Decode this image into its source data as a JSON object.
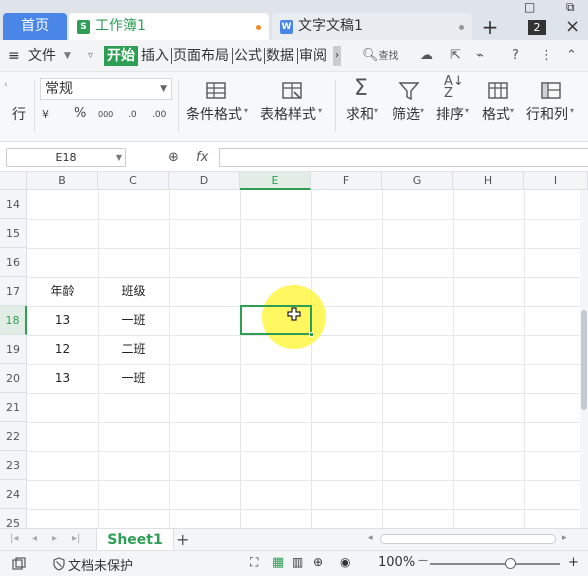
{
  "tabs": {
    "home": "首页",
    "workbook": "工作簿1",
    "workbook_icon": "S",
    "document": "文字文稿1",
    "document_icon": "W",
    "add": "+"
  },
  "window": {
    "minimize": "□",
    "restore": "⧉",
    "avatar_badge": "2",
    "close": "×"
  },
  "menu": {
    "file": "文件",
    "items": [
      "开始",
      "插入",
      "页面布局",
      "公式",
      "数据",
      "审阅"
    ],
    "search": "查找",
    "help": "?"
  },
  "ribbon": {
    "row_partial": "行",
    "number_format": "常规",
    "format_buttons": [
      "¥",
      "%",
      "000",
      ".0",
      ".00"
    ],
    "groups": [
      {
        "label": "条件格式",
        "icon": "conditional-format-icon"
      },
      {
        "label": "表格样式",
        "icon": "table-style-icon"
      },
      {
        "label": "求和",
        "icon": "sum-icon"
      },
      {
        "label": "筛选",
        "icon": "filter-icon"
      },
      {
        "label": "排序",
        "icon": "sort-icon"
      },
      {
        "label": "格式",
        "icon": "format-icon"
      },
      {
        "label": "行和列",
        "icon": "rows-columns-icon"
      }
    ]
  },
  "formula_bar": {
    "cell_ref": "E18",
    "fx": "fx",
    "formula": ""
  },
  "grid": {
    "columns": [
      "B",
      "C",
      "D",
      "E",
      "F",
      "G",
      "H",
      "I"
    ],
    "selected_column": "E",
    "rows": [
      "14",
      "15",
      "16",
      "17",
      "18",
      "19",
      "20",
      "21",
      "22",
      "23",
      "24",
      "25"
    ],
    "selected_row": "18",
    "cells": {
      "B17": "年龄",
      "C17": "班级",
      "B18": "13",
      "C18": "一班",
      "B19": "12",
      "C19": "二班",
      "B20": "13",
      "C20": "一班"
    }
  },
  "sheets": {
    "active": "Sheet1",
    "add": "+"
  },
  "status": {
    "protection": "文档未保护",
    "zoom": "100%",
    "zoom_level": 1.0,
    "zoom_minus": "—",
    "zoom_plus": "+"
  },
  "colors": {
    "accent": "#2e9e55",
    "home_tab": "#4a86e8",
    "highlight": "#fff53c"
  }
}
